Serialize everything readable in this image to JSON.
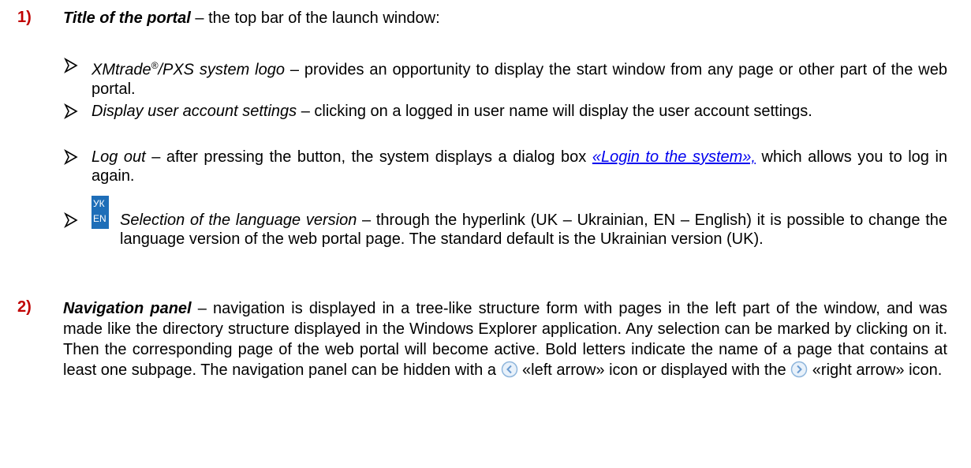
{
  "item1": {
    "number": "1)",
    "heading": "Title of the portal",
    "rest": " – the top bar of the launch window:",
    "bullets": [
      {
        "term": "XMtrade",
        "term_sup": "®",
        "term_rest": "/PXS system logo",
        "text": " – provides an opportunity to display the start window from any page or other part of the web portal."
      },
      {
        "term": "Display user account settings",
        "text": " – clicking on a logged in user name will display the user account settings."
      },
      {
        "term": "Log out",
        "text_before": " – after pressing the button, the system displays a dialog box ",
        "link": "«Login to the system»,",
        "text_after": " which allows you to log in again."
      },
      {
        "icon_uk": "УК",
        "icon_en": "EN",
        "term": "Selection of the language version",
        "text": " – through the hyperlink (UK – Ukrainian, EN – English) it is possible to change the language version of the web portal page. The standard default is the Ukrainian version (UK)."
      }
    ]
  },
  "item2": {
    "number": "2)",
    "heading": "Navigation panel",
    "text_part1": " – navigation is displayed in a tree-like structure form with pages in the left part of the window, and was made like the directory structure displayed in the Windows Explorer application. Any selection can be marked by clicking on it. Then the corresponding page of the web portal will become active. Bold letters indicate the name of a page that contains at least one subpage. The navigation panel can be hidden with a ",
    "left_icon": "left-arrow-circle-icon",
    "text_part2": " «left arrow» icon or displayed with the ",
    "right_icon": "right-arrow-circle-icon",
    "text_part3": " «right arrow» icon."
  },
  "colors": {
    "number": "#c00000",
    "link": "#0000ee",
    "lang_icon": "#1e6eb8"
  }
}
